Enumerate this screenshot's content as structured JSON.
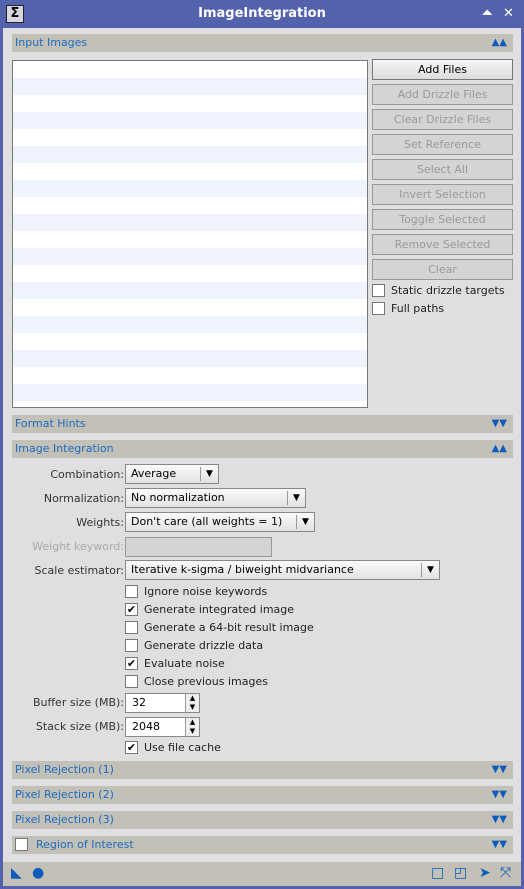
{
  "window": {
    "title": "ImageIntegration",
    "icon": "sigma-icon"
  },
  "sections": {
    "input_images": "Input Images",
    "format_hints": "Format Hints",
    "image_integration": "Image Integration",
    "pixel_rejection_1": "Pixel Rejection (1)",
    "pixel_rejection_2": "Pixel Rejection (2)",
    "pixel_rejection_3": "Pixel Rejection (3)",
    "region_of_interest": "Region of Interest"
  },
  "buttons": [
    "Add Files",
    "Add Drizzle Files",
    "Clear Drizzle Files",
    "Set Reference",
    "Select All",
    "Invert Selection",
    "Toggle Selected",
    "Remove Selected",
    "Clear"
  ],
  "input_options": {
    "static_drizzle": "Static drizzle targets",
    "full_paths": "Full paths"
  },
  "integration": {
    "combination_label": "Combination:",
    "combination": "Average",
    "normalization_label": "Normalization:",
    "normalization": "No normalization",
    "weights_label": "Weights:",
    "weights": "Don't care (all weights = 1)",
    "weight_keyword_label": "Weight keyword:",
    "weight_keyword": "",
    "scale_label": "Scale estimator:",
    "scale": "Iterative k-sigma / biweight midvariance",
    "checks": [
      {
        "label": "Ignore noise keywords",
        "checked": false
      },
      {
        "label": "Generate integrated image",
        "checked": true
      },
      {
        "label": "Generate a 64-bit result image",
        "checked": false
      },
      {
        "label": "Generate drizzle data",
        "checked": false
      },
      {
        "label": "Evaluate noise",
        "checked": true
      },
      {
        "label": "Close previous images",
        "checked": false
      }
    ],
    "buffer_label": "Buffer size (MB):",
    "buffer": "32",
    "stack_label": "Stack size (MB):",
    "stack": "2048",
    "file_cache": "Use file cache"
  },
  "colors": {
    "accent": "#1c6cc0",
    "titlebar": "#5462ad"
  }
}
